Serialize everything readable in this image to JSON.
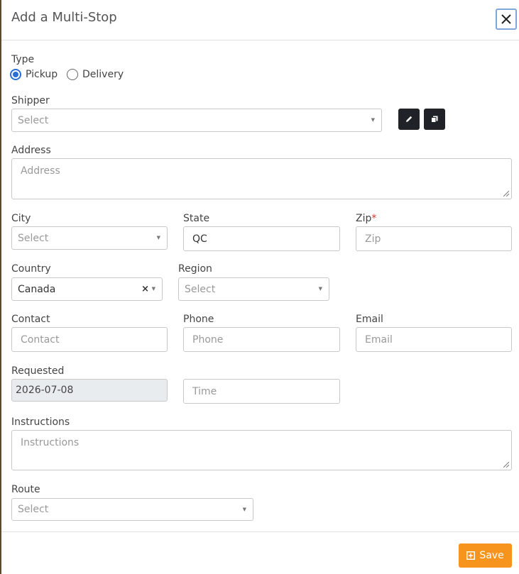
{
  "modal": {
    "title": "Add a Multi-Stop"
  },
  "type": {
    "label": "Type",
    "options": [
      "Pickup",
      "Delivery"
    ],
    "selected": "Pickup"
  },
  "shipper": {
    "label": "Shipper",
    "placeholder": "Select"
  },
  "address": {
    "label": "Address",
    "placeholder": "Address"
  },
  "city": {
    "label": "City",
    "placeholder": "Select"
  },
  "state": {
    "label": "State",
    "value": "QC"
  },
  "zip": {
    "label": "Zip",
    "required_mark": "*",
    "placeholder": "Zip"
  },
  "country": {
    "label": "Country",
    "value": "Canada",
    "clear": "×"
  },
  "region": {
    "label": "Region",
    "placeholder": "Select"
  },
  "contact": {
    "label": "Contact",
    "placeholder": "Contact"
  },
  "phone": {
    "label": "Phone",
    "placeholder": "Phone"
  },
  "email": {
    "label": "Email",
    "placeholder": "Email"
  },
  "requested": {
    "label": "Requested",
    "value": "2026-07-08"
  },
  "time": {
    "placeholder": "Time"
  },
  "instructions": {
    "label": "Instructions",
    "placeholder": "Instructions"
  },
  "route": {
    "label": "Route",
    "placeholder": "Select"
  },
  "footer": {
    "save_label": "Save"
  },
  "icons": [
    "close-icon",
    "pencil-icon",
    "copy-icon",
    "chevron-down-icon",
    "resize-handle-icon",
    "plus-square-icon"
  ],
  "colors": {
    "save_button": "#f7941d",
    "radio_selected": "#2b6fd6",
    "required": "#d9342b",
    "icon_button": "#1f2226",
    "close_focus": "#7ea6d8"
  }
}
